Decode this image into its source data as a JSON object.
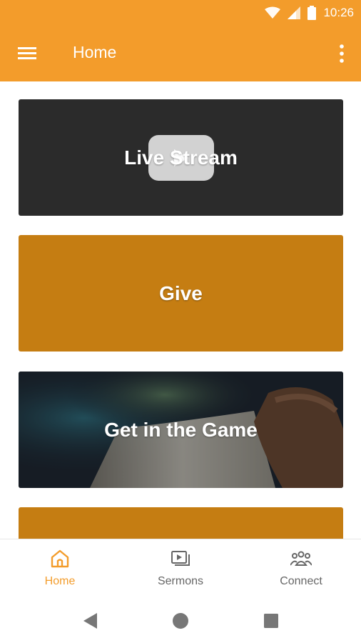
{
  "status_bar": {
    "time": "10:26"
  },
  "app_bar": {
    "title": "Home"
  },
  "cards": [
    {
      "label": "Live Stream"
    },
    {
      "label": "Give"
    },
    {
      "label": "Get in the Game"
    },
    {
      "label": ""
    }
  ],
  "bottom_nav": {
    "items": [
      {
        "label": "Home",
        "icon": "home-icon",
        "active": true
      },
      {
        "label": "Sermons",
        "icon": "sermons-icon",
        "active": false
      },
      {
        "label": "Connect",
        "icon": "connect-icon",
        "active": false
      }
    ]
  },
  "colors": {
    "primary": "#F39C2B",
    "card_gold": "#C57D12",
    "card_dark": "#2b2b2b",
    "inactive_text": "#666666"
  }
}
